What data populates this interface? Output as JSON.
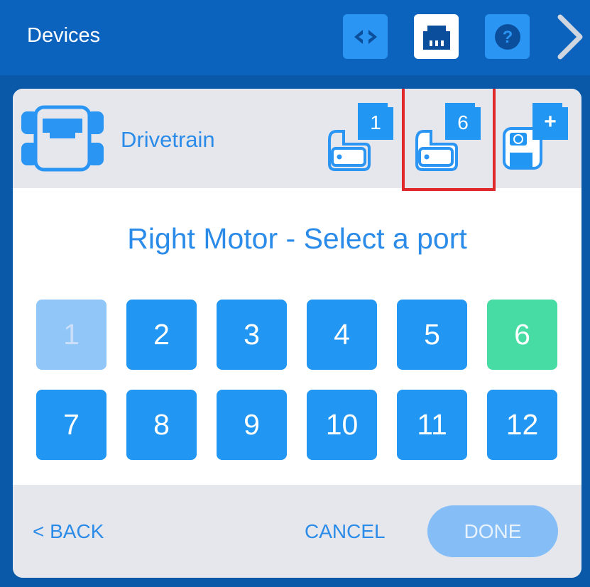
{
  "topbar": {
    "title": "Devices",
    "buttons": [
      {
        "name": "code-view",
        "icon": "code-brackets-icon"
      },
      {
        "name": "devices",
        "icon": "port-connector-icon"
      },
      {
        "name": "help",
        "icon": "question-mark-icon"
      },
      {
        "name": "next",
        "icon": "chevron-right-icon"
      }
    ]
  },
  "device": {
    "label": "Drivetrain",
    "icon": "drivetrain-icon",
    "motors": [
      {
        "port_label": "1",
        "icon": "motor-icon"
      },
      {
        "port_label": "6",
        "icon": "motor-icon",
        "highlighted": true
      },
      {
        "port_label": "+",
        "icon": "add-motor-icon"
      }
    ]
  },
  "prompt": "Right Motor - Select a port",
  "ports": [
    {
      "label": "1",
      "state": "disabled"
    },
    {
      "label": "2",
      "state": "available"
    },
    {
      "label": "3",
      "state": "available"
    },
    {
      "label": "4",
      "state": "available"
    },
    {
      "label": "5",
      "state": "available"
    },
    {
      "label": "6",
      "state": "selected"
    },
    {
      "label": "7",
      "state": "available"
    },
    {
      "label": "8",
      "state": "available"
    },
    {
      "label": "9",
      "state": "available"
    },
    {
      "label": "10",
      "state": "available"
    },
    {
      "label": "11",
      "state": "available"
    },
    {
      "label": "12",
      "state": "available"
    }
  ],
  "footer": {
    "back_label": "< BACK",
    "cancel_label": "CANCEL",
    "done_label": "DONE"
  },
  "colors": {
    "topbar": "#0b63bd",
    "accent": "#2196f3",
    "selected": "#46dca4",
    "disabled": "#90c6f8",
    "highlight": "#e0282c",
    "text_blue": "#2b8be8"
  }
}
